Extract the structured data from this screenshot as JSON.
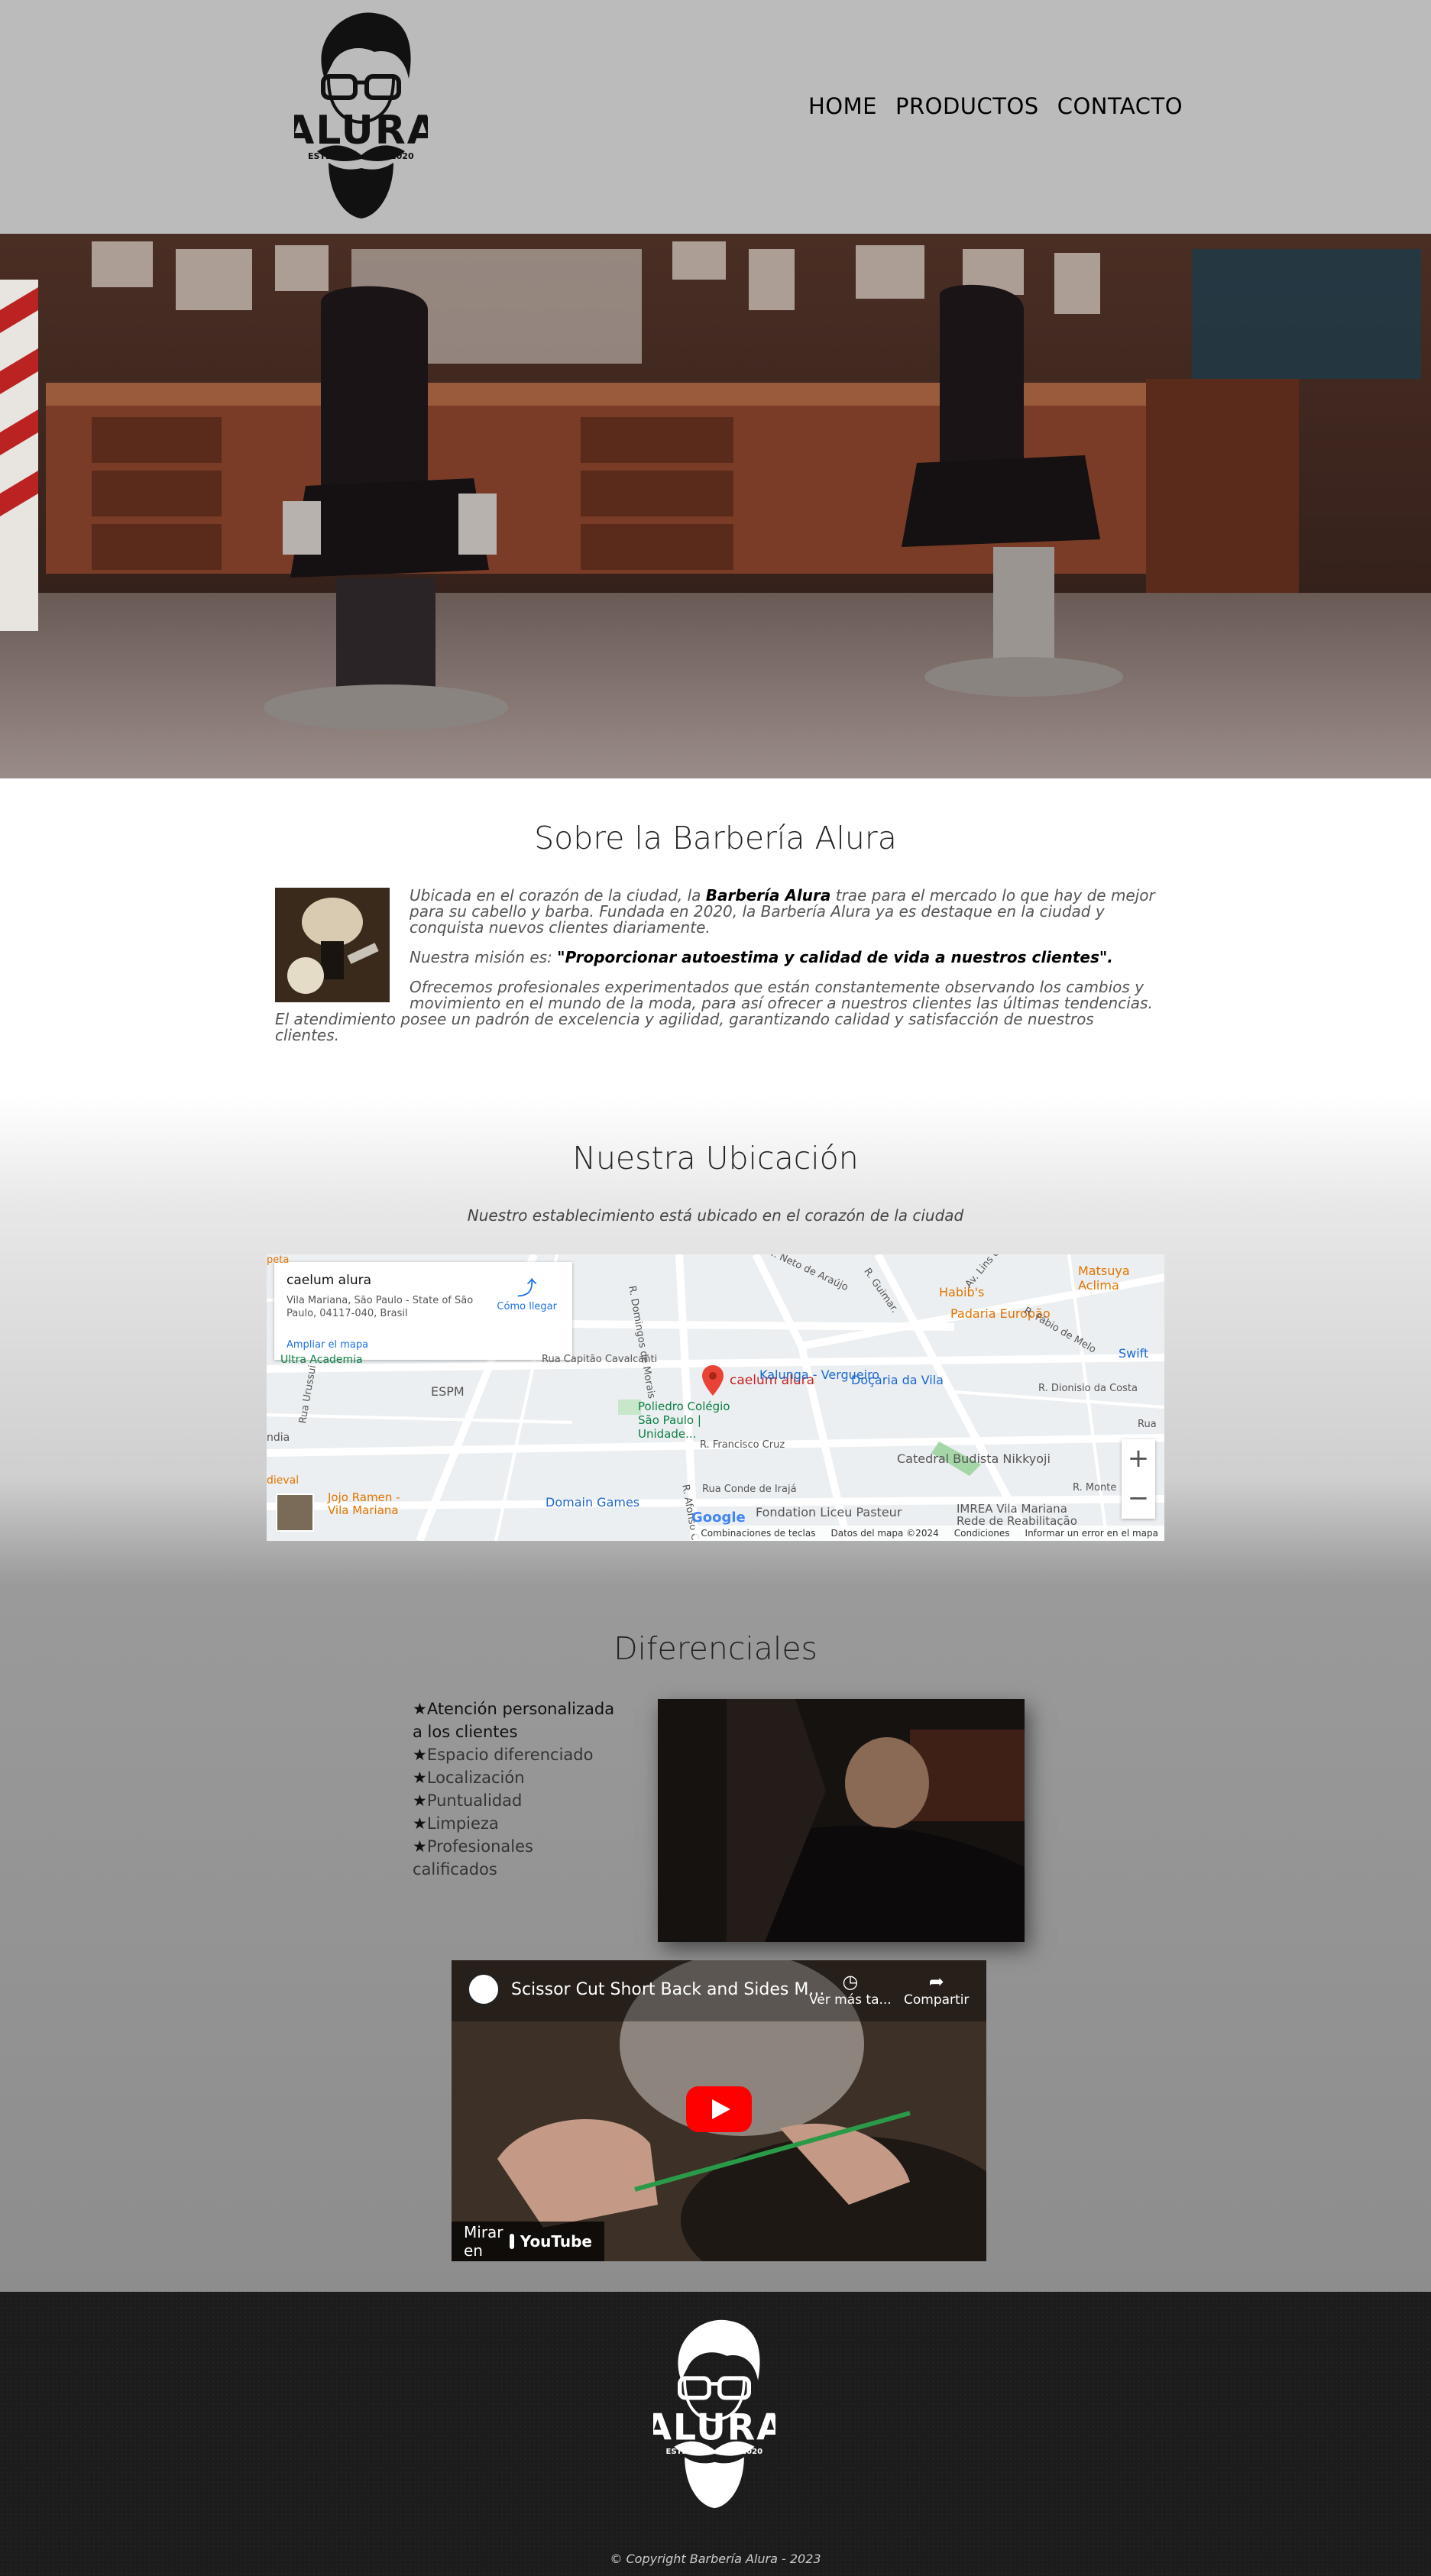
{
  "header": {
    "logo_text": "ALURA",
    "logo_estd": "ESTD",
    "logo_year": "2020",
    "nav": [
      "HOME",
      "PRODUCTOS",
      "CONTACTO"
    ]
  },
  "about": {
    "title": "Sobre la Barbería Alura",
    "p1_a": "Ubicada en el corazón de la ciudad, la ",
    "p1_strong": "Barbería Alura",
    "p1_b": " trae para el mercado lo que hay de mejor para su cabello y barba. Fundada en 2020, la Barbería Alura ya es destaque en la ciudad y conquista nuevos clientes diariamente.",
    "p2_a": "Nuestra misión es: ",
    "p2_strong": "\"Proporcionar autoestima y calidad de vida a nuestros clientes\".",
    "p3": "Ofrecemos profesionales experimentados que están constantemente observando los cambios y movimiento en el mundo de la moda, para así ofrecer a nuestros clientes las últimas tendencias. El atendimiento posee un padrón de excelencia y agilidad, garantizando calidad y satisfacción de nuestros clientes."
  },
  "location": {
    "title": "Nuestra Ubicación",
    "subtitle": "Nuestro establecimiento está ubicado en el corazón de la ciudad",
    "map": {
      "place_name": "caelum alura",
      "address": "Vila Mariana, São Paulo - State of São Paulo, 04117-040, Brasil",
      "directions": "Cómo llegar",
      "enlarge": "Ampliar el mapa",
      "marker_label": "caelum alura",
      "zoom_in": "+",
      "zoom_out": "−",
      "google": "Google",
      "labels": {
        "kalunga": "Kalunga - Vergueiro",
        "docaria": "Doçaria da Vila",
        "habibs": "Habib's",
        "padaria": "Padaria Europão",
        "matsuya": "Matsuya Aclima",
        "swift": "Swift",
        "espm": "ESPM",
        "poliedro": "Poliedro Colégio São Paulo | Unidade...",
        "catedral": "Catedral Budista Nikkyoji",
        "jojo": "Jojo Ramen - Vila Mariana",
        "domain": "Domain Games",
        "fondation": "Fondation Liceu Pasteur",
        "imrea": "IMREA Vila Mariana Rede de Reabilitação",
        "academia": "Ultra Academia",
        "medieval": "dieval",
        "india": "ndia",
        "st_cavalcanti": "Rua Capitão Cavalcanti",
        "st_domingos": "R. Domingos de Morais",
        "st_neto": "R. Dr. Neto de Araújo",
        "st_guimar": "R. Guimar.",
        "st_lins": "Av. Lins de",
        "st_fabio": "R. Fábio de Melo",
        "st_dionisio": "R. Dionisio da Costa",
        "st_francisco": "R. Francisco Cruz",
        "st_conde": "Rua Conde de Irajá",
        "st_urussui": "Rua Urussui",
        "st_afonso": "R. Afonso C",
        "st_monte": "R. Monte",
        "st_rua": "Rua",
        "pet": "peta"
      },
      "footer": [
        "Combinaciones de teclas",
        "Datos del mapa ©2024",
        "Condiciones",
        "Informar un error en el mapa"
      ]
    }
  },
  "diferenciales": {
    "title": "Diferenciales",
    "items": [
      "Atención personalizada a los clientes",
      "Espacio diferenciado",
      "Localización",
      "Puntualidad",
      "Limpieza",
      "Profesionales calificados"
    ]
  },
  "video": {
    "title": "Scissor Cut Short Back and Sides M...",
    "watch_later": "Ver más ta...",
    "share": "Compartir",
    "watch_on": "Mirar en",
    "youtube": "YouTube"
  },
  "footer": {
    "logo_text": "ALURA",
    "logo_estd": "ESTD",
    "logo_year": "2020",
    "copyright": "© Copyright Barbería Alura - 2023"
  }
}
